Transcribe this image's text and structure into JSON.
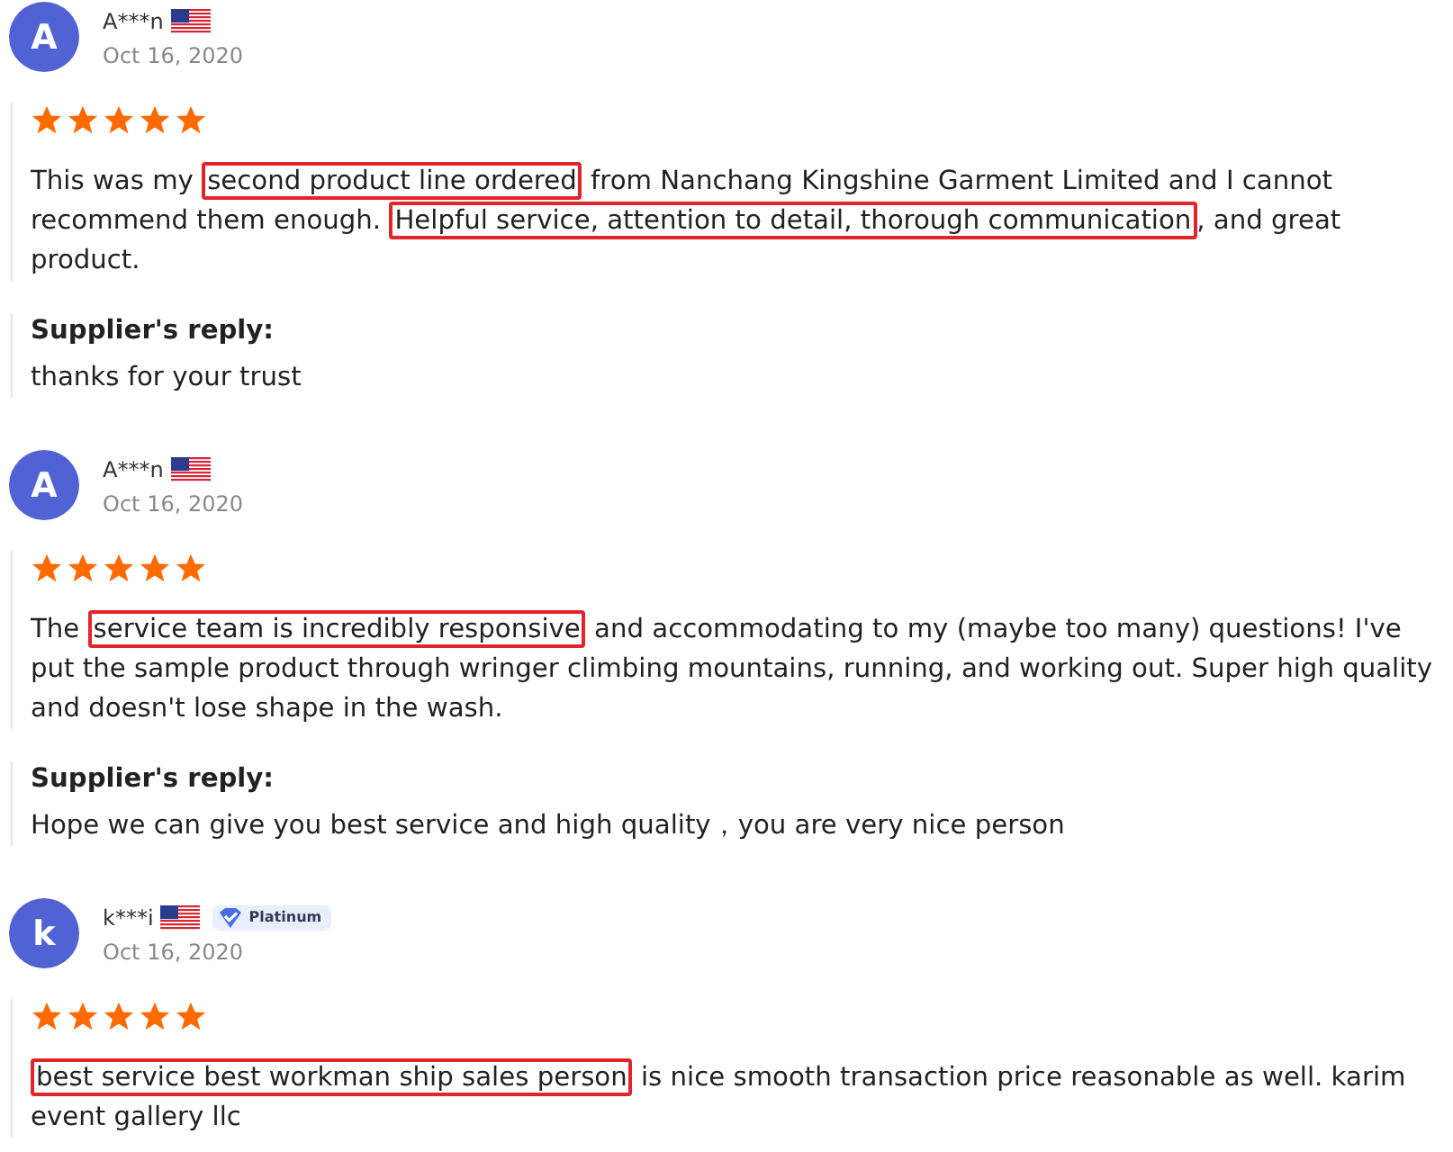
{
  "reviews": [
    {
      "avatar_letter": "A",
      "name": "A***n",
      "date": "Oct 16, 2020",
      "stars": 5,
      "segments": [
        {
          "text": "This was my ",
          "highlighted": false
        },
        {
          "text": "second product line ordered",
          "highlighted": true
        },
        {
          "text": " from Nanchang Kingshine Garment Limited and I cannot recommend them enough. ",
          "highlighted": false
        },
        {
          "text": "Helpful service, attention to detail, thorough communication",
          "highlighted": true
        },
        {
          "text": ", and great product.",
          "highlighted": false
        }
      ],
      "reply": {
        "label": "Supplier's reply:",
        "text": "thanks for your trust"
      }
    },
    {
      "avatar_letter": "A",
      "name": "A***n",
      "date": "Oct 16, 2020",
      "stars": 5,
      "segments": [
        {
          "text": "The ",
          "highlighted": false
        },
        {
          "text": "service team is incredibly responsive",
          "highlighted": true
        },
        {
          "text": " and accommodating to my (maybe too many) questions! I've put the sample product through wringer climbing mountains, running, and working out. Super high quality and doesn't lose shape in the wash.",
          "highlighted": false
        }
      ],
      "reply": {
        "label": "Supplier's reply:",
        "text": "Hope we can give you best service and high quality，you are very nice person"
      }
    },
    {
      "avatar_letter": "k",
      "name": "k***i",
      "badge": "Platinum",
      "date": "Oct 16, 2020",
      "stars": 5,
      "segments": [
        {
          "text": "best service best workman ship sales person",
          "highlighted": true
        },
        {
          "text": " is nice smooth transaction price reasonable as well. karim event gallery llc",
          "highlighted": false
        }
      ]
    }
  ]
}
